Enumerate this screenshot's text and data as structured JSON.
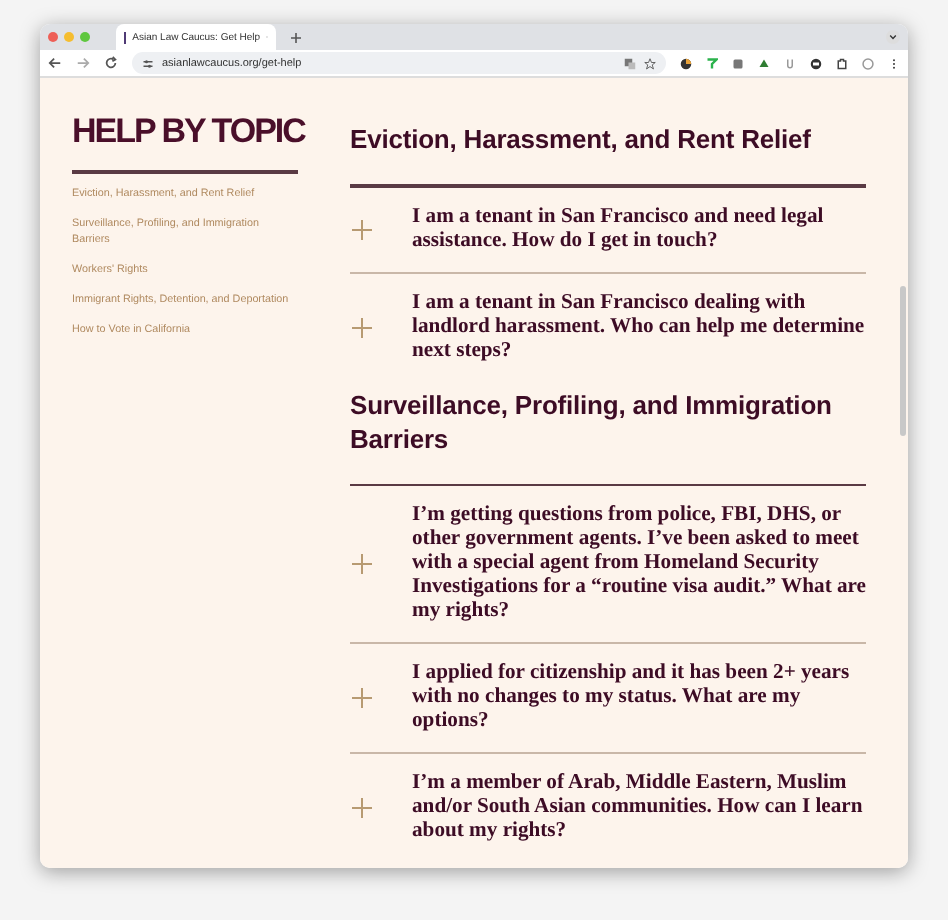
{
  "browser": {
    "tab_title": "Asian Law Caucus: Get Help",
    "url": "asianlawcaucus.org/get-help"
  },
  "sidebar": {
    "title": "HELP BY TOPIC",
    "items": [
      {
        "label": "Eviction, Harassment, and Rent Relief"
      },
      {
        "label": "Surveillance, Profiling, and Immigration Barriers"
      },
      {
        "label": "Workers' Rights"
      },
      {
        "label": "Immigrant Rights, Detention, and Deportation"
      },
      {
        "label": "How to Vote in California"
      }
    ]
  },
  "sections": [
    {
      "title": "Eviction, Harassment, and Rent Relief",
      "questions": [
        {
          "text": "I am a tenant in San Francisco and need legal assistance. How do I get in touch?",
          "expanded": false
        },
        {
          "text": "I am a tenant in San Francisco dealing with landlord harassment. Who can help me determine next steps?",
          "expanded": false
        }
      ]
    },
    {
      "title": "Surveillance, Profiling, and Immigration Barriers",
      "questions": [
        {
          "text": "I’m getting questions from police, FBI, DHS, or other government agents. I’ve been asked to meet with a special agent from Homeland Security Investigations for a “routine visa audit.” What are my rights?",
          "expanded": false
        },
        {
          "text": "I applied for citizenship and it has been 2+ years with no changes to my status. What are my options?",
          "expanded": false
        },
        {
          "text": "I’m a member of Arab, Middle Eastern, Muslim and/or South Asian communities. How can I learn about my rights?",
          "expanded": false
        }
      ]
    }
  ]
}
